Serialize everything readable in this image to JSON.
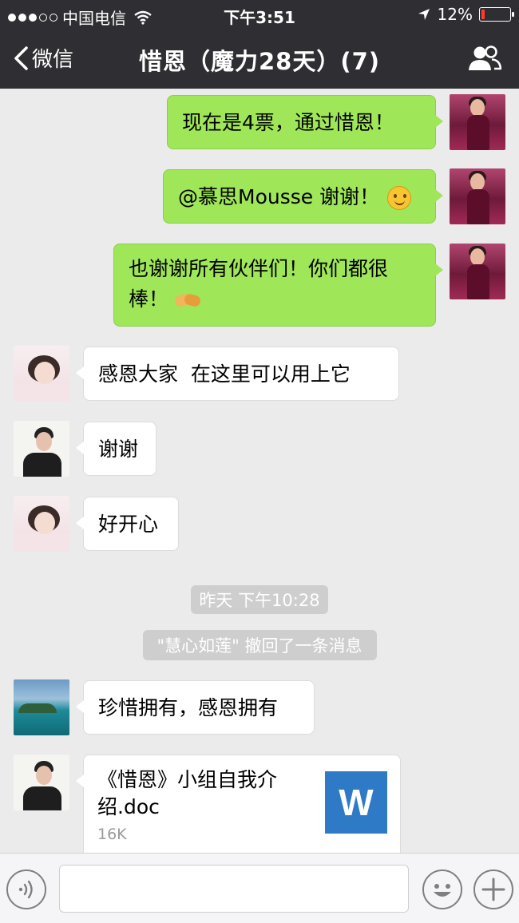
{
  "status_bar": {
    "carrier": "中国电信",
    "time": "下午3:51",
    "battery_text": "12%",
    "battery_level": 0.12,
    "signal_bars_filled": 3,
    "signal_bars_total": 5
  },
  "nav": {
    "back_label": "微信",
    "title": "惜恩（魔力28天）(7)"
  },
  "messages": [
    {
      "sender": "self",
      "avatar": "woman-red-dress",
      "text": "现在是4票，通过惜恩！"
    },
    {
      "sender": "self",
      "avatar": "woman-red-dress",
      "text": "@慕思Mousse 谢谢！",
      "emoji": "smile"
    },
    {
      "sender": "self",
      "avatar": "woman-red-dress",
      "text": "也谢谢所有伙伴们！你们都很棒！",
      "emoji": "handshake"
    },
    {
      "sender": "other",
      "avatar": "girl-pink",
      "text": "感恩大家  在这里可以用上它"
    },
    {
      "sender": "other",
      "avatar": "man-black-shirt",
      "text": "谢谢"
    },
    {
      "sender": "other",
      "avatar": "girl-pink",
      "text": "好开心"
    },
    {
      "sender": "other",
      "avatar": "sea-island",
      "text": "珍惜拥有，感恩拥有"
    }
  ],
  "system": {
    "timestamp": "昨天 下午10:28",
    "recall_notice": "\"慧心如莲\" 撤回了一条消息"
  },
  "file_message": {
    "sender": "other",
    "avatar": "man-black-shirt",
    "filename": "《惜恩》小组自我介绍.doc",
    "size": "16K",
    "icon_letter": "W"
  },
  "colors": {
    "nav_bg": "#2f2f33",
    "chat_bg": "#ebebeb",
    "bubble_self": "#9fe658",
    "bubble_other": "#ffffff",
    "word_icon": "#2f7ac7"
  },
  "icons": {
    "back": "chevron-left-icon",
    "group": "group-members-icon",
    "voice": "voice-icon",
    "emoji": "emoji-icon",
    "plus": "plus-icon"
  },
  "input": {
    "value": "",
    "placeholder": ""
  }
}
